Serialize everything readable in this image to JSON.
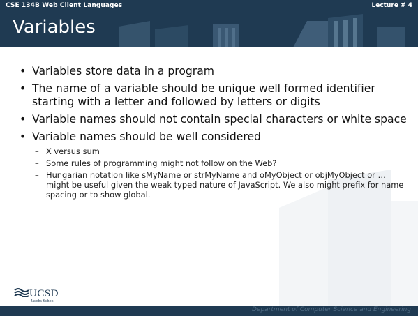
{
  "header": {
    "course": "CSE 134B  Web Client Languages",
    "lecture": "Lecture # 4",
    "title": "Variables"
  },
  "content": {
    "bullets": [
      {
        "text": "Variables store data in a program"
      },
      {
        "text": "The name of a variable should be unique well formed identifier starting with a letter and followed by letters or digits"
      },
      {
        "text": "Variable names should not contain special characters or white space"
      },
      {
        "text": "Variable names should be well considered",
        "subs": [
          "X versus sum",
          "Some rules of programming might not follow on the Web?",
          "Hungarian notation like sMyName or strMyName and oMyObject or objMyObject or … might be useful given the weak typed nature of JavaScript.  We also might prefix for name spacing or to show global."
        ]
      }
    ]
  },
  "footer": {
    "logo_text": "UCSD",
    "logo_sub": "Jacobs School",
    "department": "Department of Computer Science and Engineering"
  },
  "colors": {
    "header": "#1f3a52",
    "footer_text": "#4f6b83"
  }
}
